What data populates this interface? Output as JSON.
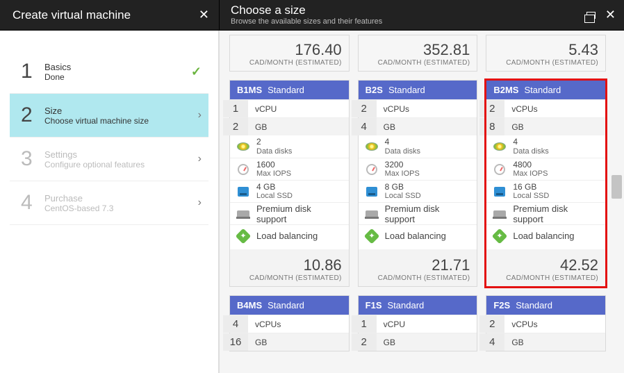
{
  "header": {
    "leftTitle": "Create virtual machine",
    "rightTitle": "Choose a size",
    "rightSubtitle": "Browse the available sizes and their features"
  },
  "wizard": {
    "steps": [
      {
        "num": "1",
        "title": "Basics",
        "sub": "Done",
        "state": "done"
      },
      {
        "num": "2",
        "title": "Size",
        "sub": "Choose virtual machine size",
        "state": "active"
      },
      {
        "num": "3",
        "title": "Settings",
        "sub": "Configure optional features",
        "state": "disabled"
      },
      {
        "num": "4",
        "title": "Purchase",
        "sub": "CentOS-based 7.3",
        "state": "disabled"
      }
    ]
  },
  "labels": {
    "perMonth": "CAD/MONTH (ESTIMATED)",
    "vcpu": "vCPU",
    "vcpus": "vCPUs",
    "gb": "GB",
    "dataDisks": "Data disks",
    "maxIops": "Max IOPS",
    "localSsd": "Local SSD",
    "premium": "Premium disk support",
    "lb": "Load balancing",
    "standard": "Standard"
  },
  "topPrices": [
    "176.40",
    "352.81",
    "5.43"
  ],
  "cards": [
    {
      "sku": "B1MS",
      "vcpu": "1",
      "vcpuLbl": "vcpu",
      "ram": "2",
      "disks": "2",
      "iops": "1600",
      "ssd": "4 GB",
      "highlight": false,
      "foot": "10.86"
    },
    {
      "sku": "B2S",
      "vcpu": "2",
      "vcpuLbl": "vcpus",
      "ram": "4",
      "disks": "4",
      "iops": "3200",
      "ssd": "8 GB",
      "highlight": false,
      "foot": "21.71"
    },
    {
      "sku": "B2MS",
      "vcpu": "2",
      "vcpuLbl": "vcpus",
      "ram": "8",
      "disks": "4",
      "iops": "4800",
      "ssd": "16 GB",
      "highlight": true,
      "foot": "42.52"
    }
  ],
  "bottomCards": [
    {
      "sku": "B4MS",
      "vcpu": "4",
      "vcpuLbl": "vcpus",
      "ram": "16"
    },
    {
      "sku": "F1S",
      "vcpu": "1",
      "vcpuLbl": "vcpu",
      "ram": "2"
    },
    {
      "sku": "F2S",
      "vcpu": "2",
      "vcpuLbl": "vcpus",
      "ram": "4"
    }
  ]
}
